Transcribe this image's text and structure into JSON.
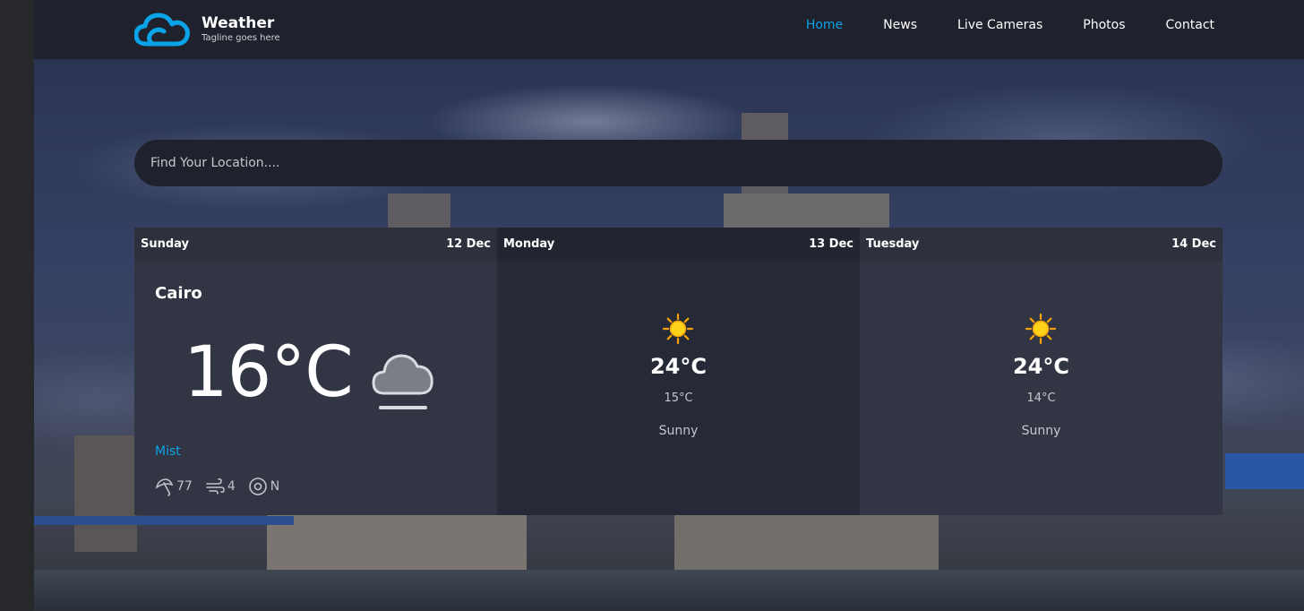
{
  "brand": {
    "name": "Weather",
    "tagline": "Tagline goes here"
  },
  "nav": [
    {
      "label": "Home",
      "active": true
    },
    {
      "label": "News",
      "active": false
    },
    {
      "label": "Live Cameras",
      "active": false
    },
    {
      "label": "Photos",
      "active": false
    },
    {
      "label": "Contact",
      "active": false
    }
  ],
  "search": {
    "placeholder": "Find Your Location...."
  },
  "today": {
    "day": "Sunday",
    "date": "12 Dec",
    "location": "Cairo",
    "temp": "16°C",
    "icon": "mist-cloud-icon",
    "condition": "Mist",
    "humidity": "77",
    "wind": "4",
    "direction": "N"
  },
  "forecast": [
    {
      "day": "Monday",
      "date": "13 Dec",
      "icon": "sun-icon",
      "max": "24°C",
      "min": "15°C",
      "condition": "Sunny"
    },
    {
      "day": "Tuesday",
      "date": "14 Dec",
      "icon": "sun-icon",
      "max": "24°C",
      "min": "14°C",
      "condition": "Sunny"
    }
  ],
  "colors": {
    "accent": "#0aa3e8",
    "header": "#1f212c",
    "card": "#323544",
    "card_alt": "#262936"
  }
}
